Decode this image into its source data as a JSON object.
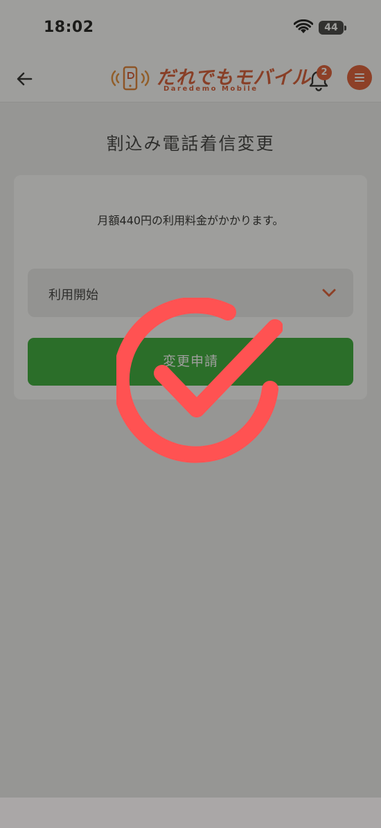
{
  "status_bar": {
    "time": "18:02",
    "battery": "44",
    "icons": [
      "wifi-icon",
      "battery-icon"
    ]
  },
  "header": {
    "logo_text": "だれでもモバイル",
    "logo_subtext": "Daredemo Mobile",
    "notification_count": "2",
    "icons": [
      "back-arrow-icon",
      "bell-icon",
      "menu-icon"
    ],
    "accent_color": "#d8532a"
  },
  "page": {
    "title": "割込み電話着信変更"
  },
  "card": {
    "notice": "月額440円の利用料金がかかります。",
    "select": {
      "value": "利用開始"
    },
    "submit_label": "変更申請",
    "submit_color": "#2ea82f"
  },
  "overlay": {
    "icon": "success-check-icon",
    "color": "#ff5252"
  }
}
